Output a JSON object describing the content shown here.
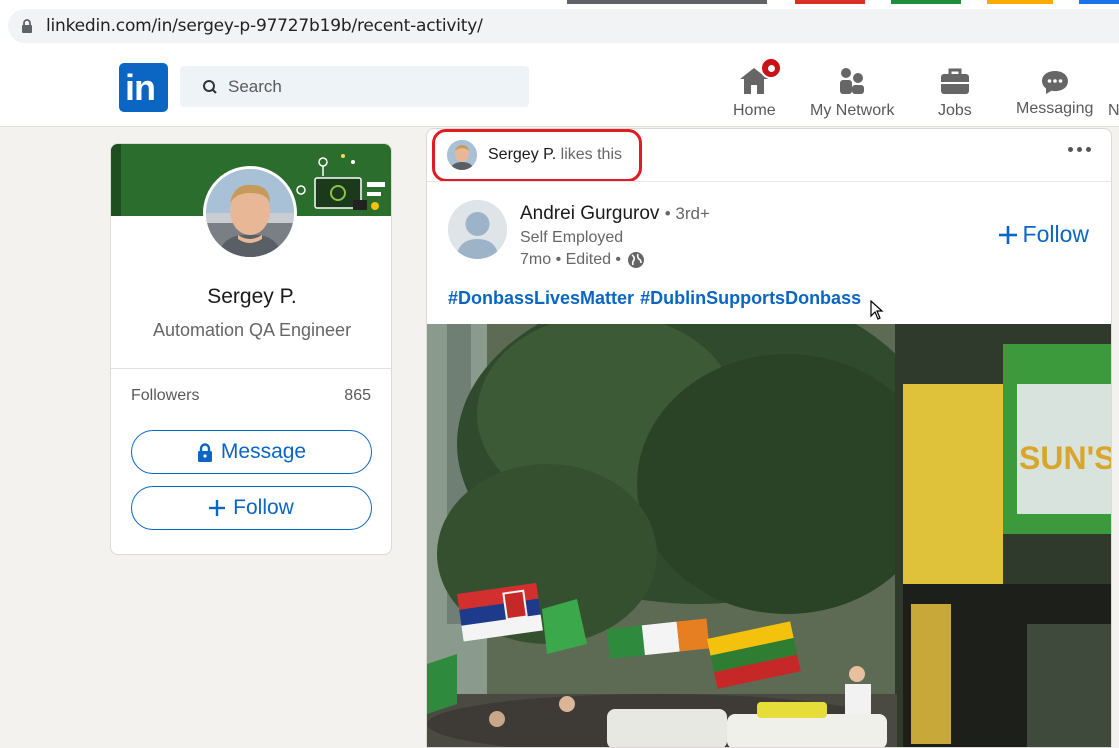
{
  "browser": {
    "url": "linkedin.com/in/sergey-p-97727b19b/recent-activity/"
  },
  "nav": {
    "logo_text": "in",
    "search_placeholder": "Search",
    "items": [
      {
        "label": "Home",
        "icon": "home-icon"
      },
      {
        "label": "My Network",
        "icon": "network-icon"
      },
      {
        "label": "Jobs",
        "icon": "briefcase-icon"
      },
      {
        "label": "Messaging",
        "icon": "messaging-icon"
      },
      {
        "label": "N"
      }
    ]
  },
  "profile": {
    "name": "Sergey P.",
    "headline": "Automation QA Engineer",
    "followers_label": "Followers",
    "followers_count": "865",
    "message_label": "Message",
    "follow_label": "Follow"
  },
  "post": {
    "liker_name": "Sergey P.",
    "liker_action": "likes this",
    "author_name": "Andrei Gurgurov",
    "author_degree": "• 3rd+",
    "author_headline": "Self Employed",
    "meta": "7mo • Edited •",
    "follow_label": "Follow",
    "hashtags": [
      "#DonbassLivesMatter",
      "#DublinSupportsDonbass"
    ]
  },
  "colors": {
    "brand": "#0a66c2",
    "highlight": "#e21b23",
    "badge": "#cc1016"
  }
}
